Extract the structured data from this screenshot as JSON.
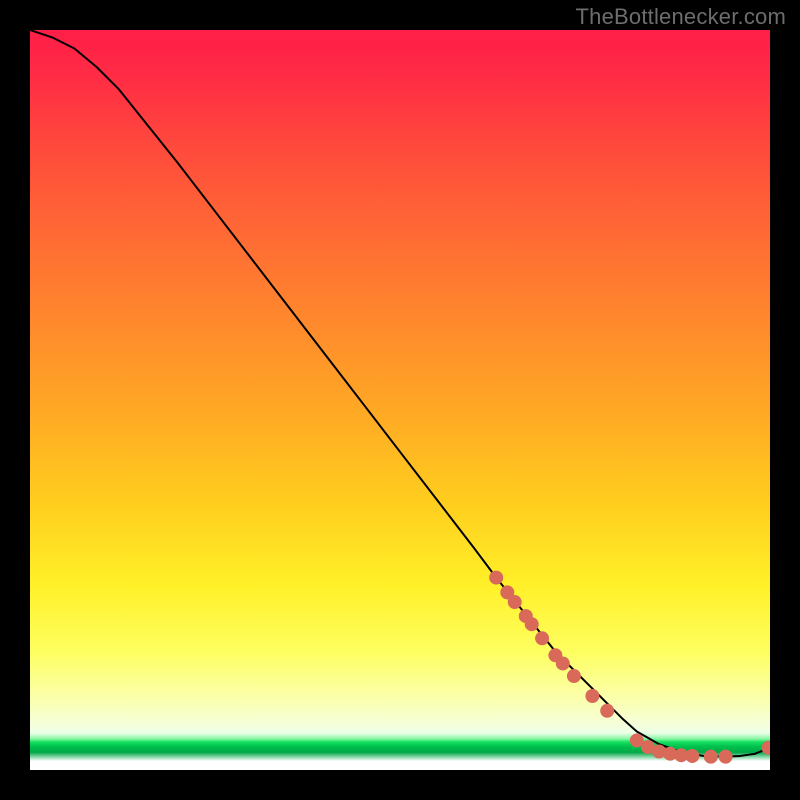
{
  "watermark": "TheBottlenecker.com",
  "chart_data": {
    "type": "line",
    "title": "",
    "xlabel": "",
    "ylabel": "",
    "xlim": [
      0,
      100
    ],
    "ylim": [
      0,
      100
    ],
    "series": [
      {
        "name": "curve",
        "x": [
          0,
          3,
          6,
          9,
          12,
          16,
          20,
          25,
          30,
          35,
          40,
          45,
          50,
          55,
          60,
          63,
          65,
          67,
          69,
          71,
          73,
          76,
          78,
          80,
          82,
          85,
          88,
          91,
          94,
          96,
          98,
          100
        ],
        "y": [
          100,
          99,
          97.5,
          95,
          92,
          87,
          82,
          75.5,
          69,
          62.5,
          56,
          49.5,
          43,
          36.5,
          30,
          26,
          23.5,
          21,
          18.5,
          16,
          14,
          11,
          9,
          7,
          5.2,
          3.5,
          2.4,
          1.9,
          1.8,
          1.9,
          2.2,
          3
        ]
      }
    ],
    "markers": [
      {
        "x": 63.0,
        "y": 26.0
      },
      {
        "x": 64.5,
        "y": 24.0
      },
      {
        "x": 65.5,
        "y": 22.7
      },
      {
        "x": 67.0,
        "y": 20.8
      },
      {
        "x": 67.8,
        "y": 19.7
      },
      {
        "x": 69.2,
        "y": 17.8
      },
      {
        "x": 71.0,
        "y": 15.5
      },
      {
        "x": 72.0,
        "y": 14.4
      },
      {
        "x": 73.5,
        "y": 12.7
      },
      {
        "x": 76.0,
        "y": 10.0
      },
      {
        "x": 78.0,
        "y": 8.0
      },
      {
        "x": 82.0,
        "y": 4.0
      },
      {
        "x": 83.5,
        "y": 3.1
      },
      {
        "x": 85.0,
        "y": 2.5
      },
      {
        "x": 86.5,
        "y": 2.2
      },
      {
        "x": 88.0,
        "y": 2.0
      },
      {
        "x": 89.5,
        "y": 1.9
      },
      {
        "x": 92.0,
        "y": 1.8
      },
      {
        "x": 94.0,
        "y": 1.8
      },
      {
        "x": 99.8,
        "y": 3.0
      }
    ],
    "marker_color": "#d96a5a",
    "line_color": "#000000"
  }
}
